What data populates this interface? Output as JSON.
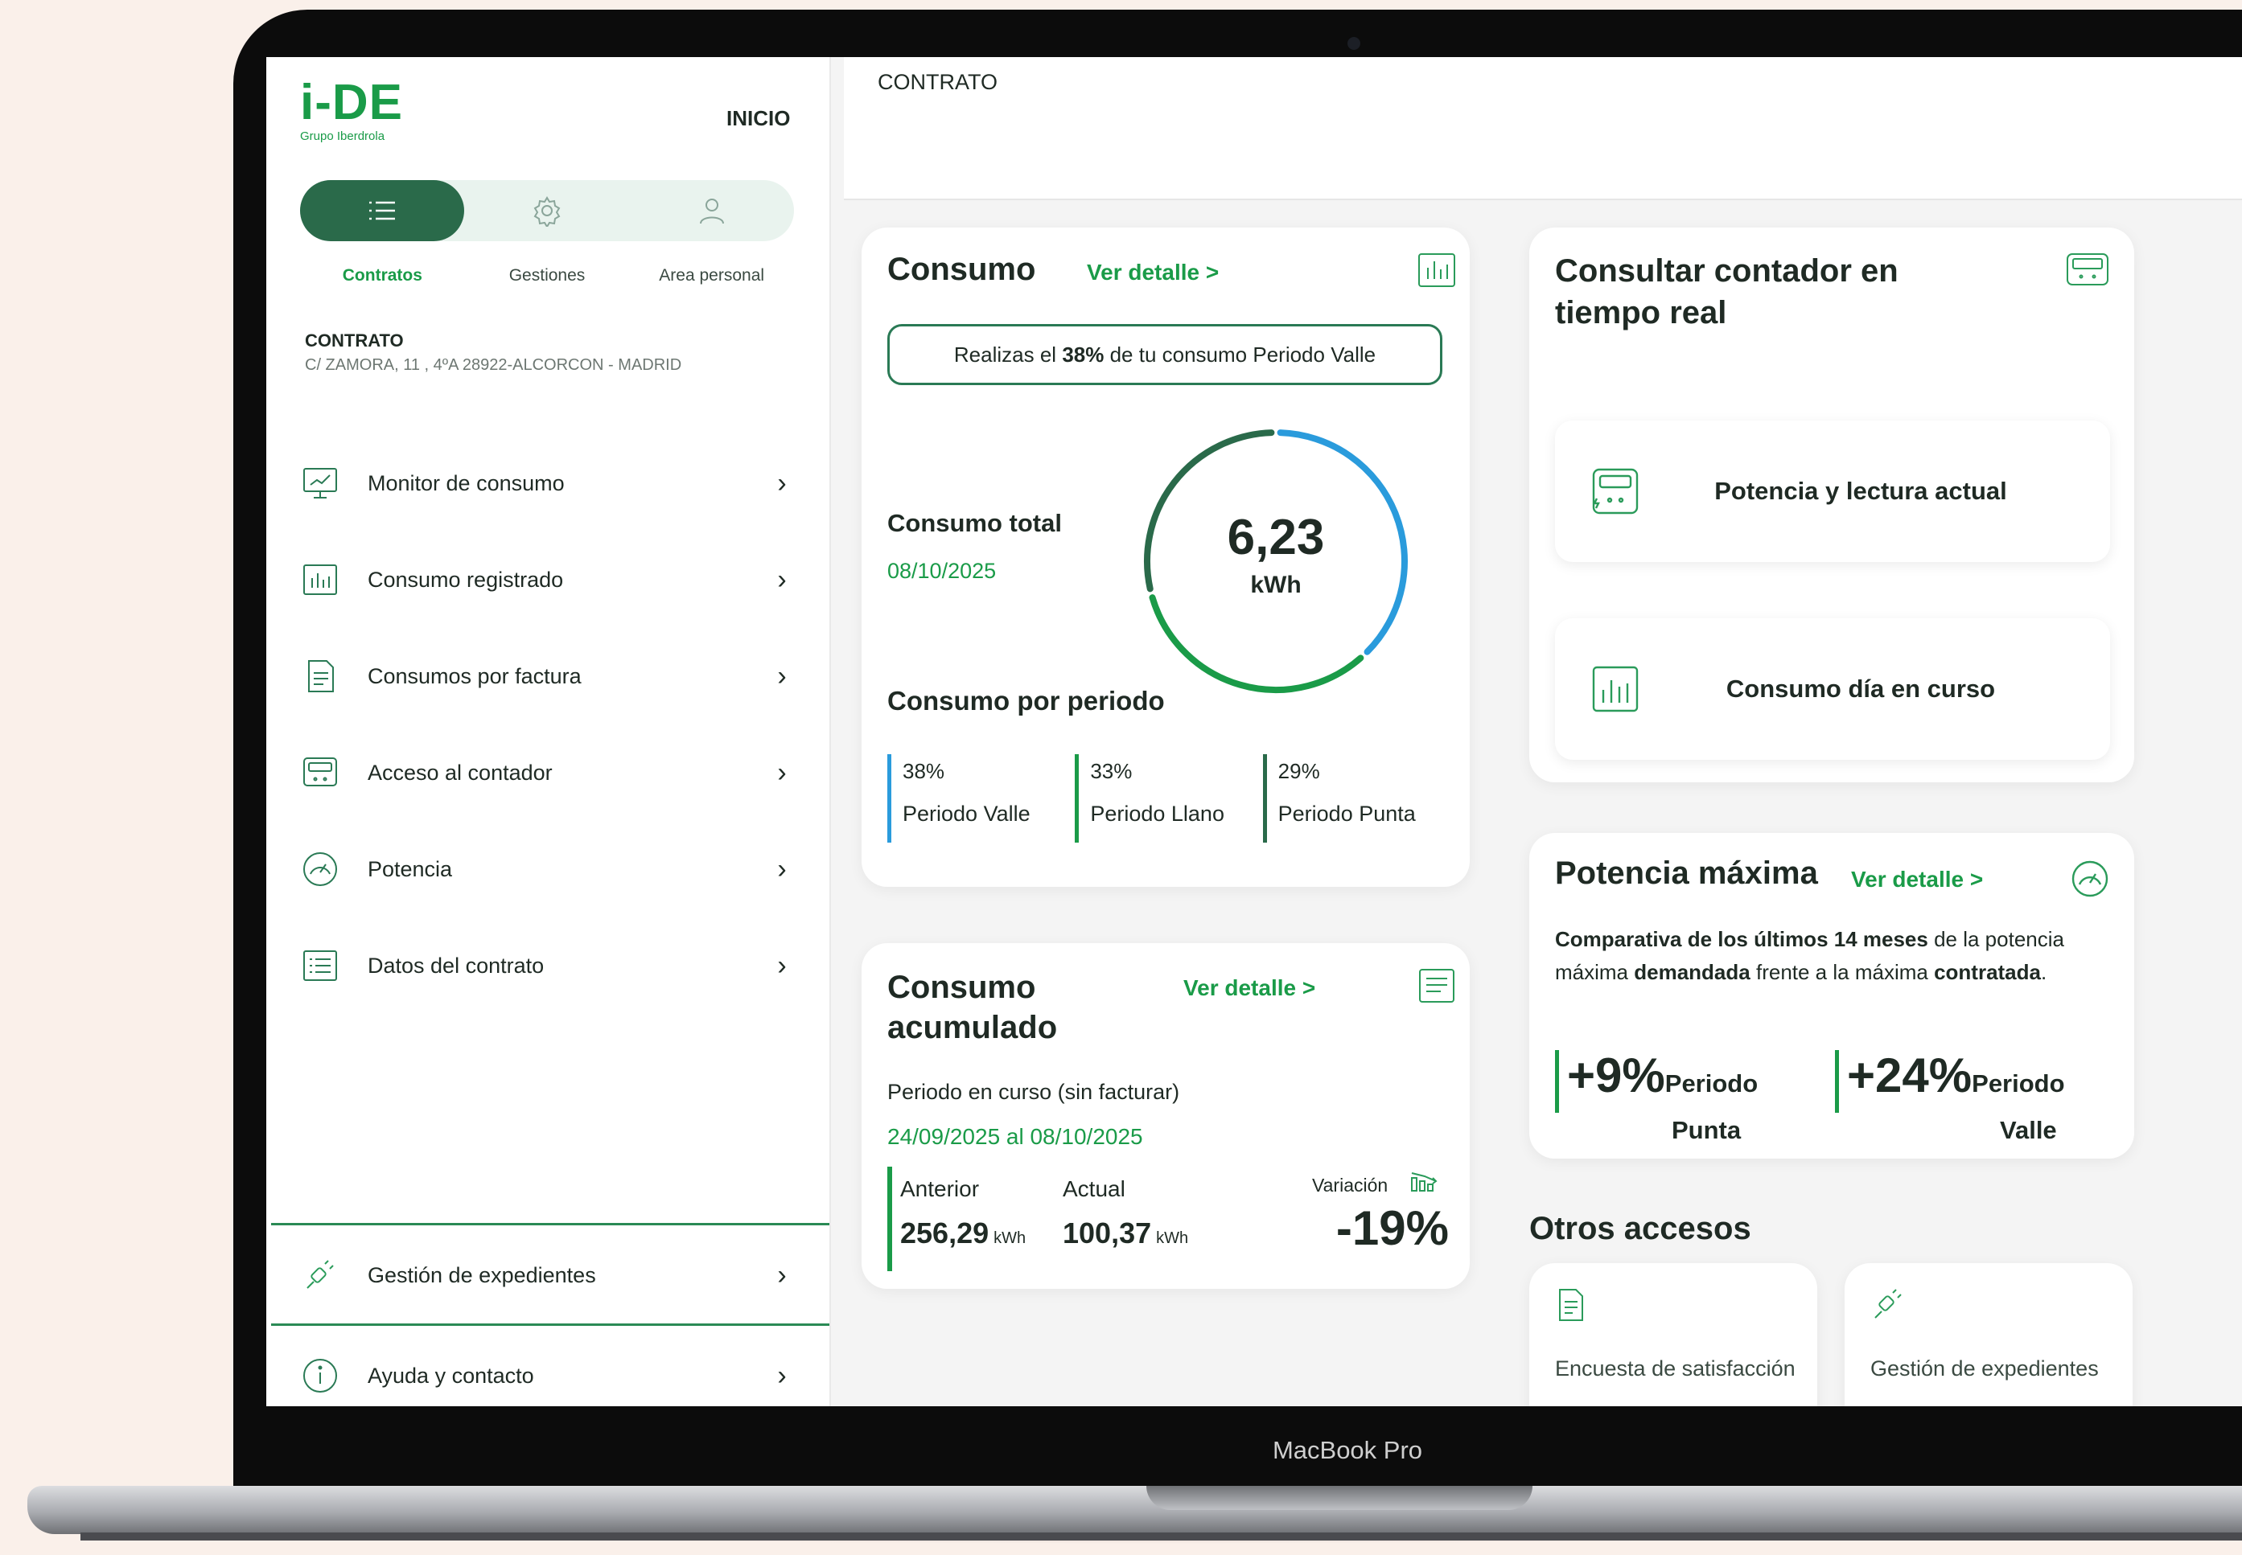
{
  "device": {
    "label": "MacBook Pro"
  },
  "brand": {
    "logo_text": "i-DE",
    "logo_sub": "Grupo Iberdrola",
    "accent": "#1a9b48",
    "dark_green": "#2a6a4a",
    "blue": "#2a9bdc"
  },
  "header": {
    "inicio": "INICIO",
    "breadcrumb": "CONTRATO"
  },
  "tabs": [
    {
      "label": "Contratos",
      "icon": "list-icon",
      "active": true
    },
    {
      "label": "Gestiones",
      "icon": "gear-icon",
      "active": false
    },
    {
      "label": "Area personal",
      "icon": "user-icon",
      "active": false
    }
  ],
  "contract": {
    "title": "CONTRATO",
    "address": "C/ ZAMORA, 11 , 4ºA 28922-ALCORCON - MADRID"
  },
  "menu": [
    {
      "label": "Monitor de consumo",
      "icon": "monitor-icon"
    },
    {
      "label": "Consumo registrado",
      "icon": "bar-chart-icon"
    },
    {
      "label": "Consumos por factura",
      "icon": "invoice-icon"
    },
    {
      "label": "Acceso al contador",
      "icon": "meter-icon"
    },
    {
      "label": "Potencia",
      "icon": "gauge-icon"
    },
    {
      "label": "Datos del contrato",
      "icon": "contract-list-icon"
    }
  ],
  "menu_bottom": [
    {
      "label": "Gestión de expedientes",
      "icon": "plug-icon"
    },
    {
      "label": "Ayuda y contacto",
      "icon": "info-icon"
    }
  ],
  "consumo": {
    "title": "Consumo",
    "link": "Ver detalle >",
    "pill_pre": "Realizas el ",
    "pill_pct": "38%",
    "pill_post": " de tu consumo Periodo Valle",
    "total_label": "Consumo total",
    "total_date": "08/10/2025",
    "total_value": "6,23",
    "total_unit": "kWh",
    "period_title": "Consumo por periodo",
    "periods": [
      {
        "pct": "38%",
        "name": "Periodo Valle",
        "share": 0.38,
        "color": "#2a9bdc"
      },
      {
        "pct": "33%",
        "name": "Periodo Llano",
        "share": 0.33,
        "color": "#1a9b48"
      },
      {
        "pct": "29%",
        "name": "Periodo Punta",
        "share": 0.29,
        "color": "#2a6a4a"
      }
    ]
  },
  "acumulado": {
    "title": "Consumo acumulado",
    "link": "Ver detalle >",
    "periodo": "Periodo en curso (sin facturar)",
    "dates": "24/09/2025 al 08/10/2025",
    "anterior_label": "Anterior",
    "actual_label": "Actual",
    "anterior_value": "256,29",
    "actual_value": "100,37",
    "unit": "kWh",
    "variacion_label": "Variación",
    "variacion_value": "-19%"
  },
  "realtime": {
    "title": "Consultar contador en tiempo real",
    "items": [
      {
        "label": "Potencia y lectura actual",
        "icon": "meter-icon"
      },
      {
        "label": "Consumo día en curso",
        "icon": "bar-chart-icon"
      }
    ]
  },
  "potencia": {
    "title": "Potencia máxima",
    "link": "Ver detalle >",
    "desc_b1": "Comparativa de los últimos 14 meses",
    "desc_t1": " de la potencia máxima ",
    "desc_b2": "demandada",
    "desc_t2": " frente a la máxima ",
    "desc_b3": "contratada",
    "desc_t3": ".",
    "stats": [
      {
        "value": "+9%",
        "label1": "Periodo",
        "label2": "Punta"
      },
      {
        "value": "+24%",
        "label1": "Periodo",
        "label2": "Valle"
      }
    ]
  },
  "otros": {
    "title": "Otros accesos",
    "items": [
      {
        "label": "Encuesta de satisfacción",
        "icon": "survey-icon"
      },
      {
        "label": "Gestión de expedientes",
        "icon": "plug-icon"
      }
    ]
  }
}
